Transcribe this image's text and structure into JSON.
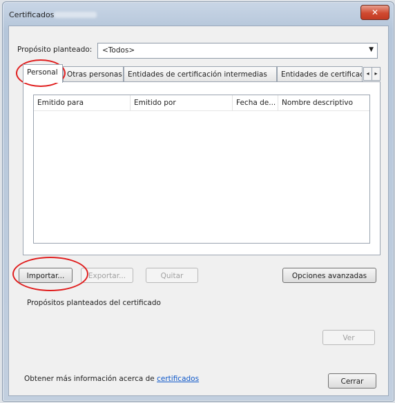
{
  "window": {
    "title": "Certificados",
    "close_glyph": "✕"
  },
  "purpose": {
    "label": "Propósito planteado:",
    "value": "<Todos>"
  },
  "tabs": [
    {
      "label": "Personal"
    },
    {
      "label": "Otras personas"
    },
    {
      "label": "Entidades de certificación intermedias"
    },
    {
      "label": "Entidades de certificaci"
    }
  ],
  "tab_scroll": {
    "left": "◂",
    "right": "▸"
  },
  "list": {
    "columns": [
      "Emitido para",
      "Emitido por",
      "Fecha de...",
      "Nombre descriptivo"
    ]
  },
  "buttons": {
    "import": "Importar...",
    "export": "Exportar...",
    "remove": "Quitar",
    "advanced": "Opciones avanzadas",
    "view": "Ver",
    "close": "Cerrar"
  },
  "purposes_label": "Propósitos planteados del certificado",
  "footer": {
    "text": "Obtener más información acerca de ",
    "link": "certificados"
  },
  "combo_arrow": "▼",
  "accent": "#e01e1e"
}
